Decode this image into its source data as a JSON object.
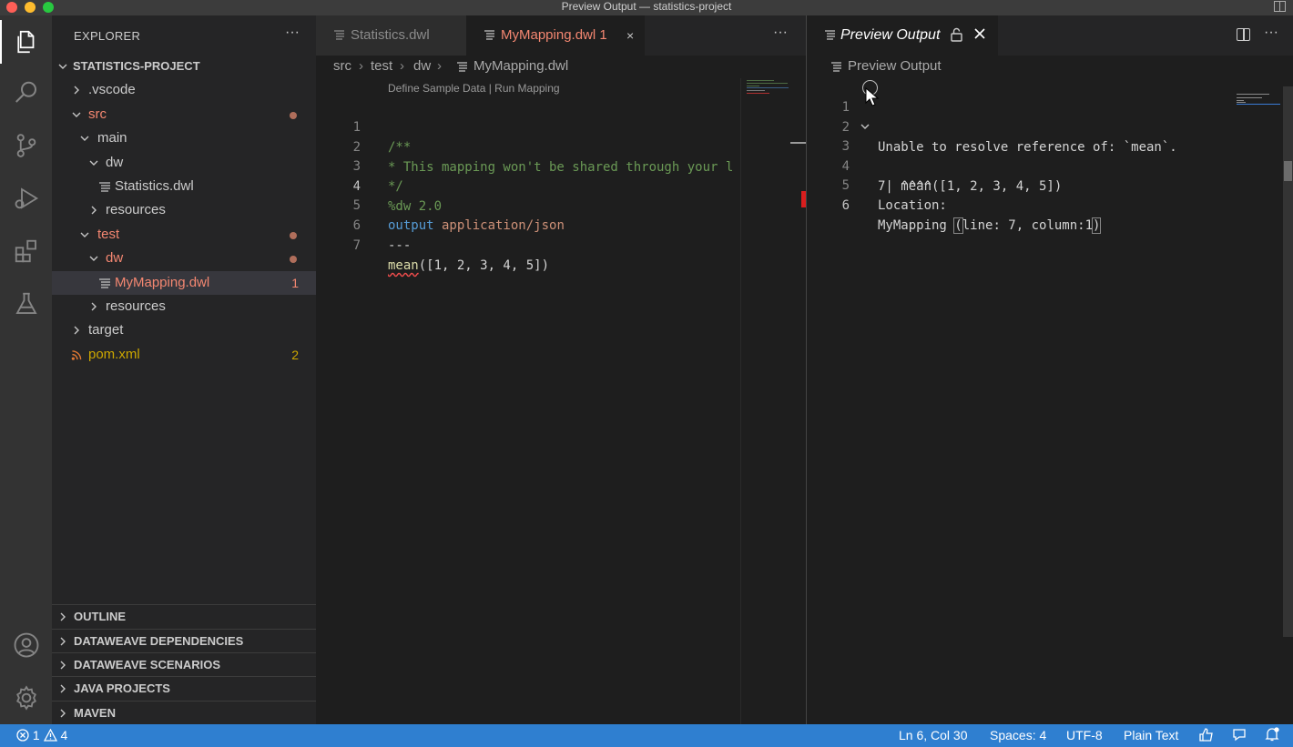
{
  "window": {
    "title": "Preview Output — statistics-project"
  },
  "activity": {
    "items": [
      "explorer-icon",
      "search-icon",
      "source-control-icon",
      "run-debug-icon",
      "extensions-icon",
      "testing-icon",
      "account-icon",
      "settings-gear-icon"
    ]
  },
  "sidebar": {
    "title": "EXPLORER",
    "more": "···",
    "tree": [
      {
        "label": "STATISTICS-PROJECT"
      },
      {
        "label": ".vscode"
      },
      {
        "label": "src"
      },
      {
        "label": "main"
      },
      {
        "label": "dw"
      },
      {
        "label": "Statistics.dwl"
      },
      {
        "label": "resources"
      },
      {
        "label": "test"
      },
      {
        "label": "dw"
      },
      {
        "label": "MyMapping.dwl",
        "badge": "1"
      },
      {
        "label": "resources"
      },
      {
        "label": "target"
      },
      {
        "label": "pom.xml",
        "badge": "2"
      }
    ],
    "sections": [
      "OUTLINE",
      "DATAWEAVE DEPENDENCIES",
      "DATAWEAVE SCENARIOS",
      "JAVA PROJECTS",
      "MAVEN"
    ]
  },
  "editor1": {
    "tabs": [
      {
        "label": "Statistics.dwl"
      },
      {
        "label": "MyMapping.dwl 1",
        "close": "×"
      }
    ],
    "more": "···",
    "breadcrumb": [
      "src",
      "test",
      "dw",
      "MyMapping.dwl"
    ],
    "codelens": "Define Sample Data | Run Mapping",
    "lines": [
      {
        "n": "1",
        "text": "/**"
      },
      {
        "n": "2",
        "text": "* This mapping won't be shared through your l"
      },
      {
        "n": "3",
        "text": "*/"
      },
      {
        "n": "4",
        "text": "%dw 2.0"
      },
      {
        "n": "5",
        "kw": "output",
        "rest": " application/json"
      },
      {
        "n": "6",
        "text": "---"
      },
      {
        "n": "7",
        "fn": "mean",
        "rest": "([1, 2, 3, 4, 5])"
      }
    ]
  },
  "preview": {
    "tab_label": "Preview Output",
    "breadcrumb": "Preview Output",
    "more": "···",
    "lines": [
      {
        "n": "1",
        "text": "Unable to resolve reference of: `mean`."
      },
      {
        "n": "2",
        "text": ""
      },
      {
        "n": "3",
        "text": "7| mean([1, 2, 3, 4, 5])"
      },
      {
        "n": "4",
        "text": "   ^^^^"
      },
      {
        "n": "5",
        "text": "Location:"
      },
      {
        "n": "6",
        "pre": "MyMapping ",
        "open": "(",
        "mid": "line: 7, column:1",
        "close": ")"
      }
    ]
  },
  "status": {
    "errors": "1",
    "warnings": "4",
    "position": "Ln 6, Col 30",
    "spaces": "Spaces: 4",
    "encoding": "UTF-8",
    "language": "Plain Text"
  },
  "colors": {
    "statusbar": "#2f7fd0",
    "modified": "#f48771",
    "warning": "#cca700"
  }
}
